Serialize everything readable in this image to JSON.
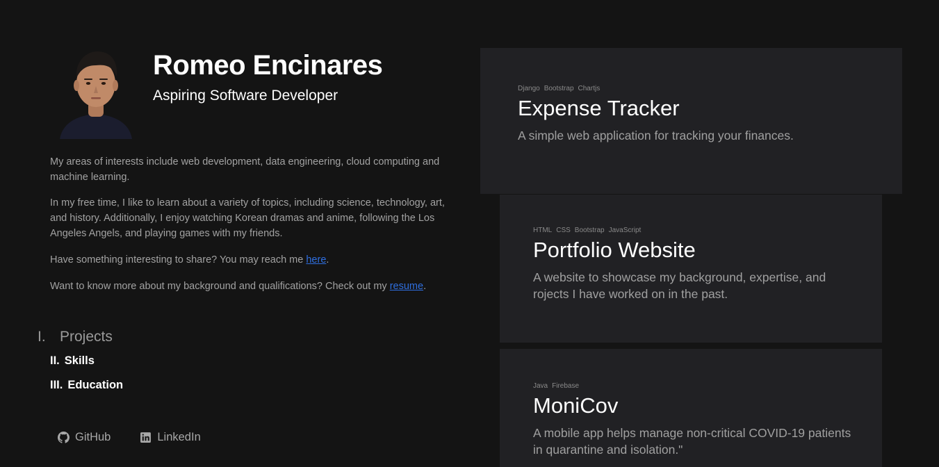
{
  "profile": {
    "name": "Romeo Encinares",
    "subtitle": "Aspiring Software Developer",
    "avatar_icon": "portrait-photo"
  },
  "about": {
    "p1": "My areas of interests include web development, data engineering, cloud computing and machine learning.",
    "p2": "In my free time, I like to learn about a variety of topics, including science, technology, art, and history. Additionally, I enjoy watching Korean dramas and anime, following the Los Angeles Angels, and playing games with my friends.",
    "p3_text": "Have something interesting to share? You may reach me ",
    "p3_link": "here",
    "p3_end": ".",
    "p4_text": "Want to know more about my background and qualifications? Check out my ",
    "p4_link": "resume",
    "p4_end": "."
  },
  "nav": [
    {
      "num": "I.",
      "label": "Projects",
      "active": true
    },
    {
      "num": "II.",
      "label": "Skills",
      "active": false
    },
    {
      "num": "III.",
      "label": "Education",
      "active": false
    }
  ],
  "socials": [
    {
      "label": "GitHub",
      "icon": "github-icon"
    },
    {
      "label": "LinkedIn",
      "icon": "linkedin-icon"
    }
  ],
  "projects": [
    {
      "tags": [
        "Django",
        "Bootstrap",
        "Chartjs"
      ],
      "title": "Expense Tracker",
      "description": "A simple web application for tracking your finances."
    },
    {
      "tags": [
        "HTML",
        "CSS",
        "Bootstrap",
        "JavaScript"
      ],
      "title": "Portfolio Website",
      "description": "A website to showcase my background, expertise, and rojects I have worked on in the past."
    },
    {
      "tags": [
        "Java",
        "Firebase"
      ],
      "title": "MoniCov",
      "description": "A mobile app helps manage non-critical COVID-19 patients in quarantine and isolation.\""
    }
  ],
  "colors": {
    "background": "#141414",
    "card": "#212124",
    "link": "#2f6fe0",
    "heading": "#ffffff"
  }
}
